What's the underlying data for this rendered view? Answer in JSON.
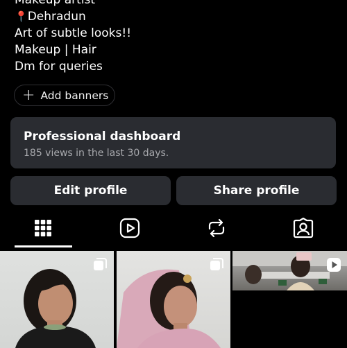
{
  "profile": {
    "bio": [
      "Makeup artist",
      "Dehradun",
      "Art of subtle looks!!",
      "Makeup | Hair",
      "Dm for queries"
    ],
    "location_icon": "pin-icon"
  },
  "banners": {
    "label": "Add banners",
    "icon": "plus-icon"
  },
  "dashboard": {
    "title": "Professional dashboard",
    "subtitle": "185 views in the last 30 days."
  },
  "actions": {
    "edit_label": "Edit profile",
    "share_label": "Share profile"
  },
  "tabs": [
    {
      "icon": "grid-icon",
      "selected": true
    },
    {
      "icon": "reels-icon",
      "selected": false
    },
    {
      "icon": "reposts-icon",
      "selected": false
    },
    {
      "icon": "tagged-icon",
      "selected": false
    }
  ],
  "posts": [
    {
      "type": "carousel",
      "icon": "carousel-icon"
    },
    {
      "type": "carousel",
      "icon": "carousel-icon"
    },
    {
      "type": "reel",
      "icon": "play-icon"
    }
  ],
  "colors": {
    "background": "#000000",
    "card": "#2a2c31",
    "secondary_text": "#a8a9ad",
    "pin": "#e0245e"
  }
}
